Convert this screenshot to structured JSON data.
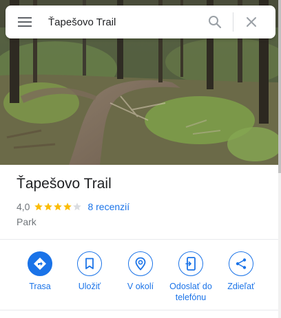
{
  "search": {
    "value": "Ťapešovo Trail"
  },
  "place": {
    "title": "Ťapešovo Trail",
    "rating": "4,0",
    "stars_filled": 4,
    "stars_total": 5,
    "reviews": "8 recenzií",
    "category": "Park"
  },
  "actions": [
    {
      "label": "Trasa",
      "icon": "directions-icon",
      "primary": true
    },
    {
      "label": "Uložiť",
      "icon": "bookmark-icon",
      "primary": false
    },
    {
      "label": "V okolí",
      "icon": "nearby-icon",
      "primary": false
    },
    {
      "label": "Odoslať do telefónu",
      "icon": "send-to-phone-icon",
      "primary": false
    },
    {
      "label": "Zdieľať",
      "icon": "share-icon",
      "primary": false
    }
  ],
  "colors": {
    "accent": "#1a73e8",
    "star": "#fbbc04",
    "text": "#202124",
    "secondary": "#70757a"
  }
}
